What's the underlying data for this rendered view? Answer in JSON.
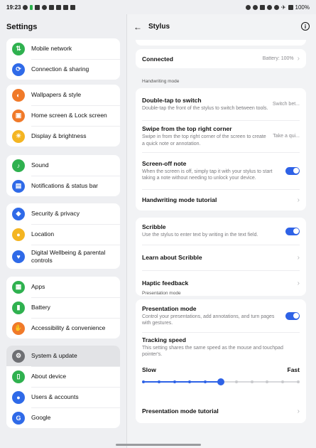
{
  "status_bar": {
    "time": "19:23",
    "battery": "100%"
  },
  "settings": {
    "title": "Settings",
    "groups": [
      [
        {
          "label": "Mobile network",
          "icon": "mobile-network-icon",
          "color": "#2fb14f"
        },
        {
          "label": "Connection & sharing",
          "icon": "connection-icon",
          "color": "#2f6ae8"
        }
      ],
      [
        {
          "label": "Wallpapers & style",
          "icon": "palette-icon",
          "color": "#f07a2a"
        },
        {
          "label": "Home screen & Lock screen",
          "icon": "home-screen-icon",
          "color": "#f07a2a"
        },
        {
          "label": "Display & brightness",
          "icon": "brightness-icon",
          "color": "#f4b522"
        }
      ],
      [
        {
          "label": "Sound",
          "icon": "bell-icon",
          "color": "#2fb14f"
        },
        {
          "label": "Notifications & status bar",
          "icon": "notification-icon",
          "color": "#2f6ae8"
        }
      ],
      [
        {
          "label": "Security & privacy",
          "icon": "shield-icon",
          "color": "#2f6ae8"
        },
        {
          "label": "Location",
          "icon": "location-icon",
          "color": "#f4b522"
        },
        {
          "label": "Digital Wellbeing & parental controls",
          "icon": "wellbeing-icon",
          "color": "#2f6ae8"
        }
      ],
      [
        {
          "label": "Apps",
          "icon": "apps-icon",
          "color": "#2fb14f"
        },
        {
          "label": "Battery",
          "icon": "battery-icon",
          "color": "#2fb14f"
        },
        {
          "label": "Accessibility & convenience",
          "icon": "accessibility-icon",
          "color": "#f07a2a"
        }
      ],
      [
        {
          "label": "System & update",
          "icon": "gear-icon",
          "color": "#6e6f73",
          "selected": true
        },
        {
          "label": "About device",
          "icon": "device-icon",
          "color": "#2fb14f"
        },
        {
          "label": "Users & accounts",
          "icon": "user-icon",
          "color": "#2f6ae8"
        },
        {
          "label": "Google",
          "icon": "google-icon",
          "color": "#2f6ae8"
        }
      ]
    ]
  },
  "stylus": {
    "title": "Stylus",
    "connected": {
      "label": "Connected",
      "value": "Battery: 100%"
    },
    "handwriting_section": "Handwriting mode",
    "double_tap": {
      "title": "Double-tap to switch",
      "desc": "Double-tap the front of the stylus to switch between tools.",
      "value": "Switch bet..."
    },
    "swipe": {
      "title": "Swipe from the top right corner",
      "desc": "Swipe in from the top right corner of the screen to create a quick note or annotation.",
      "value": "Take a qui..."
    },
    "screen_off": {
      "title": "Screen-off note",
      "desc": "When the screen is off, simply tap it with your stylus to start taking a note without needing to unlock your device.",
      "enabled": true
    },
    "handwriting_tutorial": "Handwriting mode tutorial",
    "scribble": {
      "title": "Scribble",
      "desc": "Use the stylus to enter text by writing in the text field.",
      "enabled": true
    },
    "learn_scribble": "Learn about Scribble",
    "haptic": "Haptic feedback",
    "presentation_section": "Presentation mode",
    "presentation": {
      "title": "Presentation mode",
      "desc": "Control your presentations, add annotations, and turn pages with gestures.",
      "enabled": true
    },
    "tracking": {
      "title": "Tracking speed",
      "desc": "This setting shares the same speed as the mouse and touchpad pointer's."
    },
    "slider": {
      "min_label": "Slow",
      "max_label": "Fast",
      "steps": 11,
      "value_step": 5
    },
    "presentation_tutorial": "Presentation mode tutorial"
  }
}
